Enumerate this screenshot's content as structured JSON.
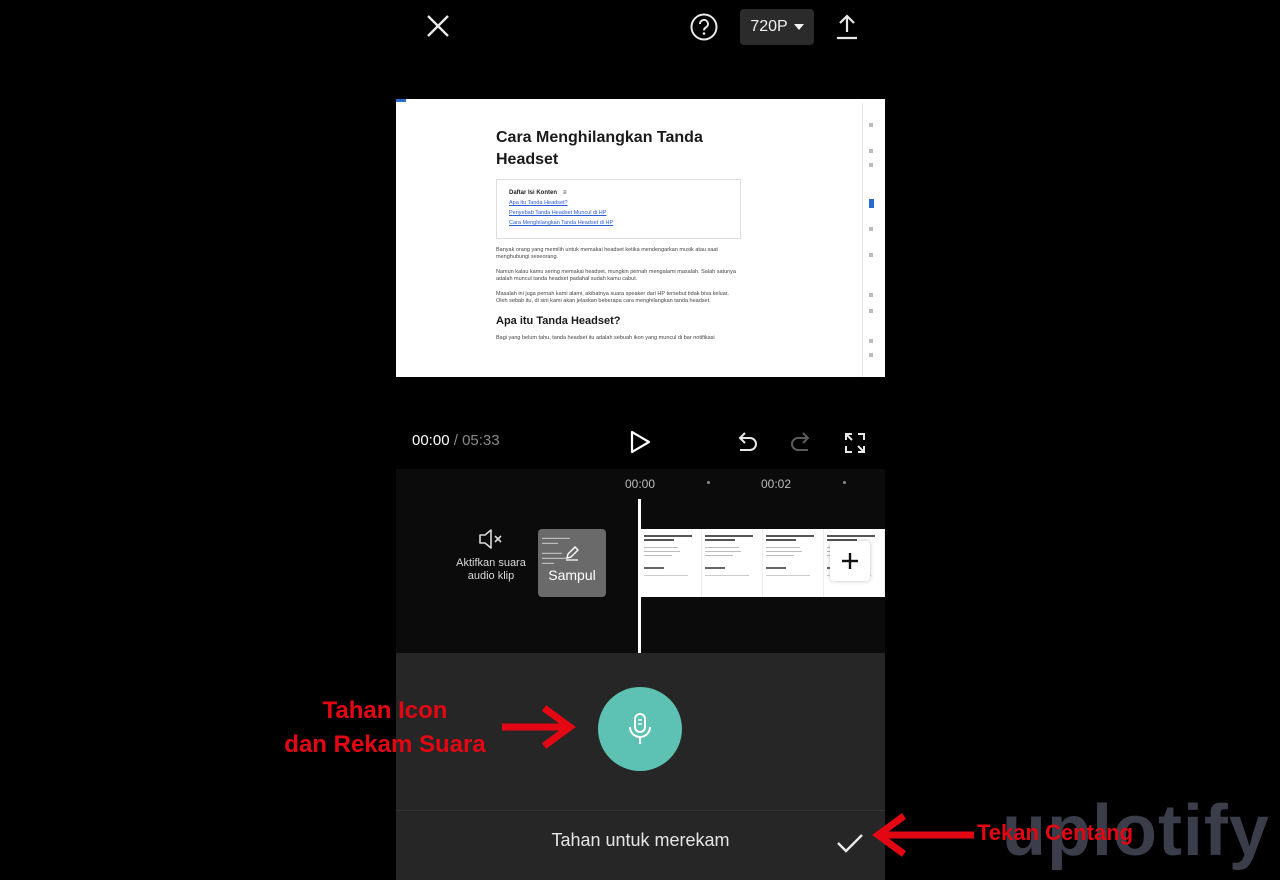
{
  "topbar": {
    "close_icon": "close-icon",
    "help_icon": "help-circle-icon",
    "quality_label": "720P",
    "export_icon": "upload-icon"
  },
  "preview": {
    "title": "Cara Menghilangkan Tanda Headset",
    "toc_title": "Daftar Isi Konten",
    "toc_links": [
      "Apa itu Tanda Headset?",
      "Penyebab Tanda Headset Muncul di HP",
      "Cara Menghilangkan Tanda Headset di HP"
    ],
    "paragraphs": [
      "Banyak orang yang memilih untuk memakai headset ketika mendengarkan musik atau saat menghubungi seseorang.",
      "Namun kalau kamu sering memakai headset, mungkin pernah mengalami masalah. Salah satunya adalah muncul tanda headset padahal sudah kamu cabut.",
      "Masalah ini juga pernah kami alami, akibatnya suara speaker dari HP tersebut tidak bisa keluar. Oleh sebab itu, di sini kami akan jelaskan beberapa cara menghilangkan tanda headset."
    ],
    "subheading": "Apa itu Tanda Headset?",
    "tail_text": "Bagi yang belum tahu, tanda headset itu adalah sebuah ikon yang muncul di bar notifikasi"
  },
  "controls": {
    "current_time": "00:00",
    "separator": " / ",
    "total_time": "05:33"
  },
  "timeline": {
    "ruler": [
      "00:00",
      "00:02"
    ],
    "mute_label": "Aktifkan suara audio klip",
    "cover_label": "Sampul",
    "frame_count": 4
  },
  "record": {
    "hint": "Tahan untuk merekam"
  },
  "annotations": {
    "left_line1": "Tahan Icon",
    "left_line2": "dan Rekam Suara",
    "right": "Tekan Centang",
    "color": "#e30613"
  },
  "watermark": "uplotify",
  "colors": {
    "background": "#000000",
    "panel": "#262626",
    "mic_button": "#5dc2b3"
  }
}
